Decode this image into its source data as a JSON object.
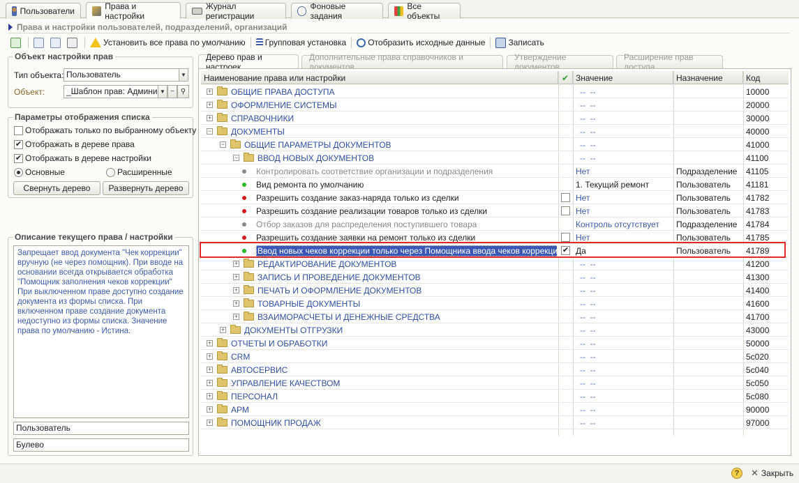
{
  "top_tabs": [
    {
      "label": "Пользователи",
      "icon": "user-icon"
    },
    {
      "label": "Права и настройки",
      "icon": "rights-icon"
    },
    {
      "label": "Журнал регистрации",
      "icon": "log-icon"
    },
    {
      "label": "Фоновые задания",
      "icon": "clock-icon"
    },
    {
      "label": "Все объекты",
      "icon": "objects-icon"
    }
  ],
  "panel_title": "Права и настройки пользователей, подразделений, организаций",
  "toolbar": {
    "default_rights": "Установить все права по умолчанию",
    "group_install": "Групповая установка",
    "show_source": "Отобразить исходные данные",
    "save": "Записать"
  },
  "object_group": {
    "title": "Объект настройки прав",
    "type_label": "Тип объекта:",
    "type_value": "Пользователь",
    "object_label": "Объект:",
    "object_value": "_Шаблон прав: Администр"
  },
  "display_group": {
    "title": "Параметры отображения списка",
    "only_selected": "Отображать только по  выбранному объекту",
    "in_rights_tree": "Отображать в дереве права",
    "in_settings_tree": "Отображать в дереве настройки",
    "radio_basic": "Основные",
    "radio_extended": "Расширенные",
    "collapse_btn": "Свернуть дерево",
    "expand_btn": "Развернуть дерево"
  },
  "description_group": {
    "title": "Описание текущего права / настройки",
    "text": "Запрещает ввод документа \"Чек коррекции\" вручную (не через помощник). При вводе на основании всегда открывается обработка \"Помощник заполнения чеков коррекции\" При выключенном праве доступно создание документа из формы списка. При включенном праве создание документа недоступно из формы списка. Значение права по умолчанию - Истина.",
    "assignee": "Пользователь",
    "value_type": "Булево"
  },
  "right_tabs": [
    "Дерево прав и настроек",
    "Дополнительные права справочников и документов",
    "Утверждение документов",
    "Расширение прав доступа"
  ],
  "grid_headers": {
    "name": "Наименование права или настройки",
    "value": "Значение",
    "assign": "Назначение",
    "code": "Код"
  },
  "rows": [
    {
      "kind": "folder",
      "level": 0,
      "exp": "+",
      "name": "ОБЩИЕ ПРАВА ДОСТУПА",
      "value": "--  --",
      "assign": "",
      "code": "10000"
    },
    {
      "kind": "folder",
      "level": 0,
      "exp": "+",
      "name": "ОФОРМЛЕНИЕ СИСТЕМЫ",
      "value": "--  --",
      "assign": "",
      "code": "20000"
    },
    {
      "kind": "folder",
      "level": 0,
      "exp": "+",
      "name": "СПРАВОЧНИКИ",
      "value": "--  --",
      "assign": "",
      "code": "30000"
    },
    {
      "kind": "folder",
      "level": 0,
      "exp": "−",
      "name": "ДОКУМЕНТЫ",
      "value": "--  --",
      "assign": "",
      "code": "40000"
    },
    {
      "kind": "folder",
      "level": 1,
      "exp": "−",
      "name": "ОБЩИЕ ПАРАМЕТРЫ ДОКУМЕНТОВ",
      "value": "--  --",
      "assign": "",
      "code": "41000"
    },
    {
      "kind": "folder",
      "level": 2,
      "exp": "−",
      "name": "ВВОД НОВЫХ ДОКУМЕНТОВ",
      "value": "--  --",
      "assign": "",
      "code": "41100"
    },
    {
      "kind": "item",
      "level": 3,
      "bullet": "#8a8a86",
      "dim": true,
      "name": "Контролировать соответствие организации и подразделения",
      "check": "",
      "value": "Нет",
      "assign": "Подразделение",
      "code": "41105"
    },
    {
      "kind": "item",
      "level": 3,
      "bullet": "#22bb22",
      "dim": false,
      "name": "Вид ремонта по умолчанию",
      "check": "",
      "value": "1. Текущий ремонт",
      "assign": "Пользователь",
      "code": "41181"
    },
    {
      "kind": "item",
      "level": 3,
      "bullet": "#d01818",
      "dim": false,
      "name": "Разрешить создание заказ-наряда только из сделки",
      "check": "empty",
      "value": "Нет",
      "assign": "Пользователь",
      "code": "41782"
    },
    {
      "kind": "item",
      "level": 3,
      "bullet": "#d01818",
      "dim": false,
      "name": "Разрешить создание реализации товаров только из сделки",
      "check": "empty",
      "value": "Нет",
      "assign": "Пользователь",
      "code": "41783"
    },
    {
      "kind": "item",
      "level": 3,
      "bullet": "#8a8a86",
      "dim": true,
      "name": "Отбор заказов для распределения поступившего товара",
      "check": "",
      "value": "Контроль отсутствует",
      "assign": "Подразделение",
      "code": "41784"
    },
    {
      "kind": "item",
      "level": 3,
      "bullet": "#d01818",
      "dim": false,
      "name": "Разрешить создание заявки на ремонт только из сделки",
      "check": "empty",
      "value": "Нет",
      "assign": "Пользователь",
      "code": "41785"
    },
    {
      "kind": "item",
      "level": 3,
      "bullet": "#22bb22",
      "dim": false,
      "selected": true,
      "name": "Ввод новых чеков коррекции только через Помощника ввода чеков коррекции",
      "check": "checked",
      "value": "Да",
      "assign": "Пользователь",
      "code": "41789"
    },
    {
      "kind": "folder",
      "level": 2,
      "exp": "+",
      "name": "РЕДАКТИРОВАНИЕ ДОКУМЕНТОВ",
      "value": "--  --",
      "assign": "",
      "code": "41200"
    },
    {
      "kind": "folder",
      "level": 2,
      "exp": "+",
      "name": "ЗАПИСЬ И ПРОВЕДЕНИЕ ДОКУМЕНТОВ",
      "value": "--  --",
      "assign": "",
      "code": "41300"
    },
    {
      "kind": "folder",
      "level": 2,
      "exp": "+",
      "name": "ПЕЧАТЬ И ОФОРМЛЕНИЕ ДОКУМЕНТОВ",
      "value": "--  --",
      "assign": "",
      "code": "41400"
    },
    {
      "kind": "folder",
      "level": 2,
      "exp": "+",
      "name": "ТОВАРНЫЕ ДОКУМЕНТЫ",
      "value": "--  --",
      "assign": "",
      "code": "41600"
    },
    {
      "kind": "folder",
      "level": 2,
      "exp": "+",
      "name": "ВЗАИМОРАСЧЕТЫ И ДЕНЕЖНЫЕ СРЕДСТВА",
      "value": "--  --",
      "assign": "",
      "code": "41700"
    },
    {
      "kind": "folder",
      "level": 1,
      "exp": "+",
      "name": "ДОКУМЕНТЫ ОТГРУЗКИ",
      "value": "--  --",
      "assign": "",
      "code": "43000"
    },
    {
      "kind": "folder",
      "level": 0,
      "exp": "+",
      "name": "ОТЧЕТЫ И ОБРАБОТКИ",
      "value": "--  --",
      "assign": "",
      "code": "50000"
    },
    {
      "kind": "folder",
      "level": 0,
      "exp": "+",
      "name": "CRM",
      "value": "--  --",
      "assign": "",
      "code": "5c020"
    },
    {
      "kind": "folder",
      "level": 0,
      "exp": "+",
      "name": "АВТОСЕРВИС",
      "value": "--  --",
      "assign": "",
      "code": "5c040"
    },
    {
      "kind": "folder",
      "level": 0,
      "exp": "+",
      "name": "УПРАВЛЕНИЕ КАЧЕСТВОМ",
      "value": "--  --",
      "assign": "",
      "code": "5c050"
    },
    {
      "kind": "folder",
      "level": 0,
      "exp": "+",
      "name": "ПЕРСОНАЛ",
      "value": "--  --",
      "assign": "",
      "code": "5c080"
    },
    {
      "kind": "folder",
      "level": 0,
      "exp": "+",
      "name": "АРМ",
      "value": "--  --",
      "assign": "",
      "code": "90000"
    },
    {
      "kind": "folder",
      "level": 0,
      "exp": "+",
      "name": "ПОМОЩНИК ПРОДАЖ",
      "value": "--  --",
      "assign": "",
      "code": "97000"
    }
  ],
  "bottom": {
    "help": "?",
    "close": "Закрыть"
  }
}
